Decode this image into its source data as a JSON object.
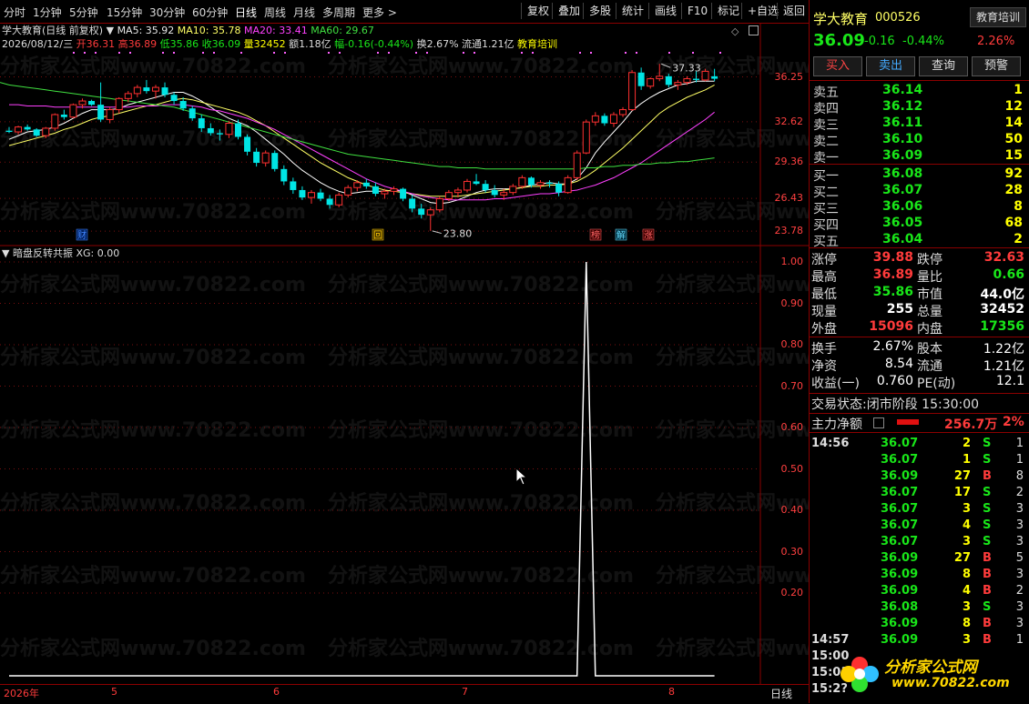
{
  "toolbar": {
    "periods": [
      "分时",
      "1分钟",
      "5分钟",
      "15分钟",
      "30分钟",
      "60分钟",
      "日线",
      "周线",
      "月线",
      "多周期",
      "更多 >"
    ],
    "actions": [
      "复权",
      "叠加",
      "多股",
      "统计",
      "画线",
      "F10",
      "标记",
      "+自选",
      "返回"
    ]
  },
  "chart_header": {
    "stock_label": "学大教育(日线 前复权)",
    "ma5": "MA5: 35.92",
    "ma10": "MA10: 35.78",
    "ma20": "MA20: 33.41",
    "ma60": "MA60: 29.67",
    "date": "2026/08/12/三",
    "open": "开36.31",
    "high": "高36.89",
    "low": "低35.86",
    "close": "收36.09",
    "vol": "量32452",
    "amount": "额1.18亿",
    "change": "幅-0.16(-0.44%)",
    "turnover": "换2.67%",
    "float_cap": "流通1.21亿",
    "concept": "教育培训"
  },
  "price_axis": [
    "36.25",
    "32.62",
    "29.36",
    "26.43",
    "23.78"
  ],
  "annotations": {
    "high_label": "37.33",
    "low_label": "23.80"
  },
  "event_markers": [
    "财",
    "回",
    "榜",
    "解",
    "涨"
  ],
  "indicator": {
    "title": "暗盘反转共振",
    "xg": "XG: 0.00",
    "axis": [
      "1.00",
      "0.90",
      "0.80",
      "0.70",
      "0.60",
      "0.50",
      "0.40",
      "0.30",
      "0.20"
    ]
  },
  "time_axis": {
    "labels": [
      "2026年",
      "5",
      "6",
      "7",
      "8"
    ],
    "period": "日线"
  },
  "chart_data": [
    {
      "type": "candlestick",
      "title": "学大教育(日线 前复权)",
      "ylim": [
        23.2,
        38.2
      ],
      "candles": [
        [
          31.9,
          32.2,
          31.7,
          31.8
        ],
        [
          31.8,
          32.3,
          31.6,
          32.2
        ],
        [
          32.2,
          32.4,
          31.9,
          32.0
        ],
        [
          32.0,
          32.1,
          31.4,
          31.5
        ],
        [
          31.5,
          32.2,
          31.3,
          32.1
        ],
        [
          32.1,
          33.3,
          31.9,
          33.2
        ],
        [
          33.2,
          33.6,
          32.8,
          33.0
        ],
        [
          33.0,
          34.1,
          32.9,
          34.0
        ],
        [
          34.0,
          34.5,
          33.7,
          34.3
        ],
        [
          34.3,
          34.4,
          33.9,
          34.0
        ],
        [
          34.0,
          35.8,
          32.6,
          32.8
        ],
        [
          32.8,
          33.8,
          32.5,
          33.6
        ],
        [
          33.6,
          34.6,
          33.3,
          34.5
        ],
        [
          34.5,
          35.1,
          34.2,
          34.9
        ],
        [
          34.9,
          35.6,
          34.6,
          35.4
        ],
        [
          35.4,
          36.0,
          34.9,
          35.1
        ],
        [
          35.1,
          35.6,
          34.5,
          35.4
        ],
        [
          35.4,
          35.8,
          34.6,
          34.8
        ],
        [
          34.8,
          35.0,
          34.0,
          34.3
        ],
        [
          34.3,
          34.6,
          33.5,
          33.7
        ],
        [
          33.7,
          33.9,
          32.7,
          32.9
        ],
        [
          32.9,
          33.2,
          31.8,
          32.1
        ],
        [
          32.1,
          32.5,
          31.5,
          31.7
        ],
        [
          31.7,
          32.0,
          31.1,
          31.6
        ],
        [
          31.6,
          32.7,
          31.3,
          32.5
        ],
        [
          32.5,
          32.8,
          31.2,
          31.4
        ],
        [
          31.4,
          31.6,
          29.9,
          30.2
        ],
        [
          30.2,
          30.5,
          29.0,
          29.3
        ],
        [
          29.3,
          30.3,
          29.0,
          30.1
        ],
        [
          30.1,
          30.3,
          28.6,
          28.8
        ],
        [
          28.8,
          29.1,
          27.5,
          27.8
        ],
        [
          27.8,
          28.1,
          26.8,
          27.1
        ],
        [
          27.1,
          27.4,
          26.3,
          26.5
        ],
        [
          26.5,
          27.1,
          26.0,
          26.9
        ],
        [
          26.9,
          27.2,
          26.2,
          26.4
        ],
        [
          26.4,
          26.7,
          25.6,
          25.9
        ],
        [
          25.9,
          26.9,
          25.7,
          26.7
        ],
        [
          26.7,
          27.5,
          26.5,
          27.3
        ],
        [
          27.3,
          27.9,
          27.0,
          27.7
        ],
        [
          27.7,
          28.0,
          27.2,
          27.4
        ],
        [
          27.4,
          27.7,
          26.6,
          26.8
        ],
        [
          26.8,
          27.2,
          26.4,
          27.0
        ],
        [
          27.0,
          27.4,
          26.7,
          27.2
        ],
        [
          27.2,
          27.3,
          26.2,
          26.4
        ],
        [
          26.4,
          26.7,
          25.3,
          25.6
        ],
        [
          25.6,
          26.0,
          24.8,
          25.1
        ],
        [
          25.1,
          25.7,
          23.8,
          25.5
        ],
        [
          25.5,
          26.6,
          25.3,
          26.4
        ],
        [
          26.4,
          27.1,
          26.2,
          26.9
        ],
        [
          26.9,
          27.3,
          26.5,
          27.1
        ],
        [
          27.1,
          28.0,
          26.9,
          27.8
        ],
        [
          27.8,
          28.4,
          27.5,
          27.6
        ],
        [
          27.6,
          27.9,
          26.9,
          27.1
        ],
        [
          27.1,
          27.5,
          26.5,
          26.7
        ],
        [
          26.7,
          27.2,
          26.3,
          26.9
        ],
        [
          26.9,
          27.6,
          26.7,
          27.4
        ],
        [
          27.4,
          28.3,
          27.2,
          28.1
        ],
        [
          28.1,
          28.2,
          27.3,
          27.5
        ],
        [
          27.5,
          27.9,
          27.2,
          27.7
        ],
        [
          27.7,
          27.9,
          27.3,
          27.6
        ],
        [
          27.6,
          27.8,
          26.6,
          26.9
        ],
        [
          26.9,
          28.3,
          26.8,
          28.1
        ],
        [
          28.1,
          30.3,
          27.9,
          30.1
        ],
        [
          30.1,
          32.8,
          30.0,
          32.6
        ],
        [
          32.6,
          33.4,
          32.3,
          33.1
        ],
        [
          33.1,
          33.3,
          32.3,
          32.5
        ],
        [
          32.5,
          33.4,
          32.2,
          33.2
        ],
        [
          33.2,
          33.8,
          33.0,
          33.6
        ],
        [
          33.6,
          36.8,
          33.5,
          36.6
        ],
        [
          36.6,
          37.0,
          35.2,
          35.5
        ],
        [
          35.5,
          36.2,
          35.3,
          36.1
        ],
        [
          36.1,
          37.3,
          35.9,
          36.3
        ],
        [
          36.3,
          36.5,
          35.4,
          35.6
        ],
        [
          35.6,
          36.0,
          35.2,
          35.8
        ],
        [
          35.8,
          36.3,
          35.6,
          36.1
        ],
        [
          36.1,
          36.7,
          35.8,
          36.0
        ],
        [
          36.0,
          36.9,
          35.9,
          36.7
        ],
        [
          36.3,
          36.9,
          35.9,
          36.1
        ]
      ],
      "ma": {
        "MA5": [
          31.2,
          31.5,
          31.8,
          31.9,
          32.0,
          32.2,
          32.5,
          32.9,
          33.3,
          33.6,
          33.6,
          33.6,
          33.7,
          34.0,
          34.2,
          34.4,
          34.6,
          34.8,
          35.0,
          35.0,
          34.7,
          34.3,
          33.8,
          33.3,
          32.9,
          32.6,
          32.3,
          31.8,
          31.2,
          30.6,
          30.0,
          29.3,
          28.7,
          28.2,
          27.7,
          27.3,
          27.0,
          26.8,
          26.9,
          27.0,
          27.0,
          27.0,
          27.1,
          27.0,
          26.7,
          26.4,
          26.1,
          26.0,
          26.1,
          26.3,
          26.6,
          26.9,
          27.1,
          27.2,
          27.2,
          27.2,
          27.3,
          27.5,
          27.6,
          27.7,
          27.6,
          27.6,
          28.0,
          28.9,
          30.1,
          31.0,
          31.8,
          32.6,
          33.5,
          34.1,
          34.6,
          35.0,
          35.3,
          35.6,
          35.7,
          35.9,
          35.9,
          35.9
        ],
        "MA10": [
          30.7,
          30.9,
          31.1,
          31.3,
          31.5,
          31.7,
          32.0,
          32.2,
          32.5,
          32.8,
          33.0,
          33.1,
          33.3,
          33.5,
          33.7,
          33.9,
          34.0,
          34.2,
          34.4,
          34.5,
          34.4,
          34.2,
          34.0,
          33.8,
          33.6,
          33.4,
          33.1,
          32.7,
          32.3,
          31.8,
          31.3,
          30.8,
          30.3,
          29.8,
          29.3,
          28.9,
          28.5,
          28.1,
          27.8,
          27.5,
          27.3,
          27.1,
          27.0,
          26.9,
          26.8,
          26.7,
          26.6,
          26.6,
          26.6,
          26.6,
          26.7,
          26.8,
          26.9,
          27.0,
          27.1,
          27.2,
          27.3,
          27.4,
          27.4,
          27.5,
          27.5,
          27.6,
          27.8,
          28.2,
          28.7,
          29.3,
          29.9,
          30.5,
          31.2,
          31.9,
          32.6,
          33.3,
          33.8,
          34.2,
          34.6,
          34.9,
          35.2,
          35.6
        ],
        "MA20": [
          34.0,
          34.0,
          33.9,
          33.9,
          33.9,
          33.8,
          33.8,
          33.8,
          33.8,
          33.8,
          33.8,
          33.8,
          33.8,
          33.8,
          33.9,
          33.9,
          33.9,
          34.0,
          34.0,
          34.0,
          33.9,
          33.8,
          33.6,
          33.5,
          33.3,
          33.1,
          32.9,
          32.6,
          32.3,
          32.0,
          31.6,
          31.2,
          30.8,
          30.4,
          30.0,
          29.6,
          29.2,
          28.8,
          28.4,
          28.0,
          27.7,
          27.4,
          27.2,
          27.0,
          26.8,
          26.6,
          26.5,
          26.4,
          26.3,
          26.3,
          26.3,
          26.3,
          26.3,
          26.4,
          26.4,
          26.5,
          26.6,
          26.7,
          26.8,
          26.8,
          26.9,
          27.0,
          27.1,
          27.3,
          27.5,
          27.8,
          28.1,
          28.5,
          28.9,
          29.3,
          29.8,
          30.3,
          30.8,
          31.3,
          31.8,
          32.3,
          32.8,
          33.4
        ],
        "MA60": [
          35.6,
          35.5,
          35.4,
          35.3,
          35.2,
          35.1,
          35.0,
          34.9,
          34.8,
          34.7,
          34.6,
          34.5,
          34.4,
          34.3,
          34.2,
          34.1,
          34.0,
          33.9,
          33.8,
          33.6,
          33.4,
          33.2,
          33.0,
          32.8,
          32.6,
          32.4,
          32.2,
          32.0,
          31.8,
          31.6,
          31.4,
          31.2,
          31.0,
          30.8,
          30.6,
          30.4,
          30.2,
          30.0,
          29.9,
          29.8,
          29.7,
          29.6,
          29.5,
          29.4,
          29.3,
          29.2,
          29.1,
          29.0,
          29.0,
          28.9,
          28.9,
          28.9,
          28.8,
          28.8,
          28.8,
          28.8,
          28.8,
          28.8,
          28.8,
          28.8,
          28.8,
          28.8,
          28.8,
          28.9,
          28.9,
          29.0,
          29.0,
          29.1,
          29.1,
          29.2,
          29.2,
          29.3,
          29.3,
          29.4,
          29.4,
          29.5,
          29.6,
          29.7
        ]
      }
    },
    {
      "type": "line",
      "title": "暗盘反转共振",
      "ylim": [
        0,
        1.0
      ],
      "series": [
        {
          "name": "XG",
          "values": [
            0,
            0,
            0,
            0,
            0,
            0,
            0,
            0,
            0,
            0,
            0,
            0,
            0,
            0,
            0,
            0,
            0,
            0,
            0,
            0,
            0,
            0,
            0,
            0,
            0,
            0,
            0,
            0,
            0,
            0,
            0,
            0,
            0,
            0,
            0,
            0,
            0,
            0,
            0,
            0,
            0,
            0,
            0,
            0,
            0,
            0,
            0,
            0,
            0,
            0,
            0,
            0,
            0,
            0,
            0,
            0,
            0,
            0,
            0,
            0,
            0,
            0,
            0,
            1,
            0,
            0,
            0,
            0,
            0,
            0,
            0,
            0,
            0,
            0,
            0,
            0,
            0,
            0
          ]
        }
      ]
    }
  ],
  "quote": {
    "name": "学大教育",
    "code": "000526",
    "tag": "教育培训",
    "price": "36.09",
    "change": "-0.16",
    "pct": "-0.44%",
    "ratio": "2.26%",
    "buttons": [
      "买入",
      "卖出",
      "查询",
      "预警"
    ],
    "asks": [
      {
        "label": "卖五",
        "price": "36.14",
        "vol": "1"
      },
      {
        "label": "卖四",
        "price": "36.12",
        "vol": "12"
      },
      {
        "label": "卖三",
        "price": "36.11",
        "vol": "14"
      },
      {
        "label": "卖二",
        "price": "36.10",
        "vol": "50"
      },
      {
        "label": "卖一",
        "price": "36.09",
        "vol": "15"
      }
    ],
    "bids": [
      {
        "label": "买一",
        "price": "36.08",
        "vol": "92"
      },
      {
        "label": "买二",
        "price": "36.07",
        "vol": "28"
      },
      {
        "label": "买三",
        "price": "36.06",
        "vol": "8"
      },
      {
        "label": "买四",
        "price": "36.05",
        "vol": "68"
      },
      {
        "label": "买五",
        "price": "36.04",
        "vol": "2"
      }
    ],
    "stats": [
      {
        "l1": "涨停",
        "v1": "39.88",
        "l2": "跌停",
        "v2": "32.63"
      },
      {
        "l1": "最高",
        "v1": "36.89",
        "l2": "量比",
        "v2": "0.66"
      },
      {
        "l1": "最低",
        "v1": "35.86",
        "l2": "市值",
        "v2": "44.0亿"
      },
      {
        "l1": "现量",
        "v1": "255",
        "l2": "总量",
        "v2": "32452"
      },
      {
        "l1": "外盘",
        "v1": "15096",
        "l2": "内盘",
        "v2": "17356"
      }
    ],
    "stats2": [
      {
        "l1": "换手",
        "v1": "2.67%",
        "l2": "股本",
        "v2": "1.22亿"
      },
      {
        "l1": "净资",
        "v1": "8.54",
        "l2": "流通",
        "v2": "1.21亿"
      },
      {
        "l1": "收益(一)",
        "v1": "0.760",
        "l2": "PE(动)",
        "v2": "12.1"
      }
    ],
    "trade_status": "交易状态:闭市阶段 15:30:00",
    "main_force_label": "主力净额",
    "main_force_value": "256.7万",
    "main_force_pct": "2%",
    "ticks": [
      {
        "t": "14:56",
        "p": "36.07",
        "v": "2",
        "bs": "S",
        "n": "1"
      },
      {
        "t": "",
        "p": "36.07",
        "v": "1",
        "bs": "S",
        "n": "1"
      },
      {
        "t": "",
        "p": "36.09",
        "v": "27",
        "bs": "B",
        "n": "8"
      },
      {
        "t": "",
        "p": "36.07",
        "v": "17",
        "bs": "S",
        "n": "2"
      },
      {
        "t": "",
        "p": "36.07",
        "v": "3",
        "bs": "S",
        "n": "3"
      },
      {
        "t": "",
        "p": "36.07",
        "v": "4",
        "bs": "S",
        "n": "3"
      },
      {
        "t": "",
        "p": "36.07",
        "v": "3",
        "bs": "S",
        "n": "3"
      },
      {
        "t": "",
        "p": "36.09",
        "v": "27",
        "bs": "B",
        "n": "5"
      },
      {
        "t": "",
        "p": "36.09",
        "v": "8",
        "bs": "B",
        "n": "3"
      },
      {
        "t": "",
        "p": "36.09",
        "v": "4",
        "bs": "B",
        "n": "2"
      },
      {
        "t": "",
        "p": "36.08",
        "v": "3",
        "bs": "S",
        "n": "3"
      },
      {
        "t": "",
        "p": "36.09",
        "v": "8",
        "bs": "B",
        "n": "3"
      },
      {
        "t": "14:57",
        "p": "36.09",
        "v": "3",
        "bs": "B",
        "n": "1"
      },
      {
        "t": "15:00",
        "p": "",
        "v": "",
        "bs": "",
        "n": ""
      },
      {
        "t": "15:01",
        "p": "",
        "v": "",
        "bs": "",
        "n": ""
      },
      {
        "t": "15:2?",
        "p": "",
        "v": "",
        "bs": "",
        "n": ""
      }
    ]
  },
  "watermark": {
    "text": "分析家公式网www.70822.com",
    "logo_text": "分析家公式网",
    "logo_url": "www.70822.com"
  }
}
